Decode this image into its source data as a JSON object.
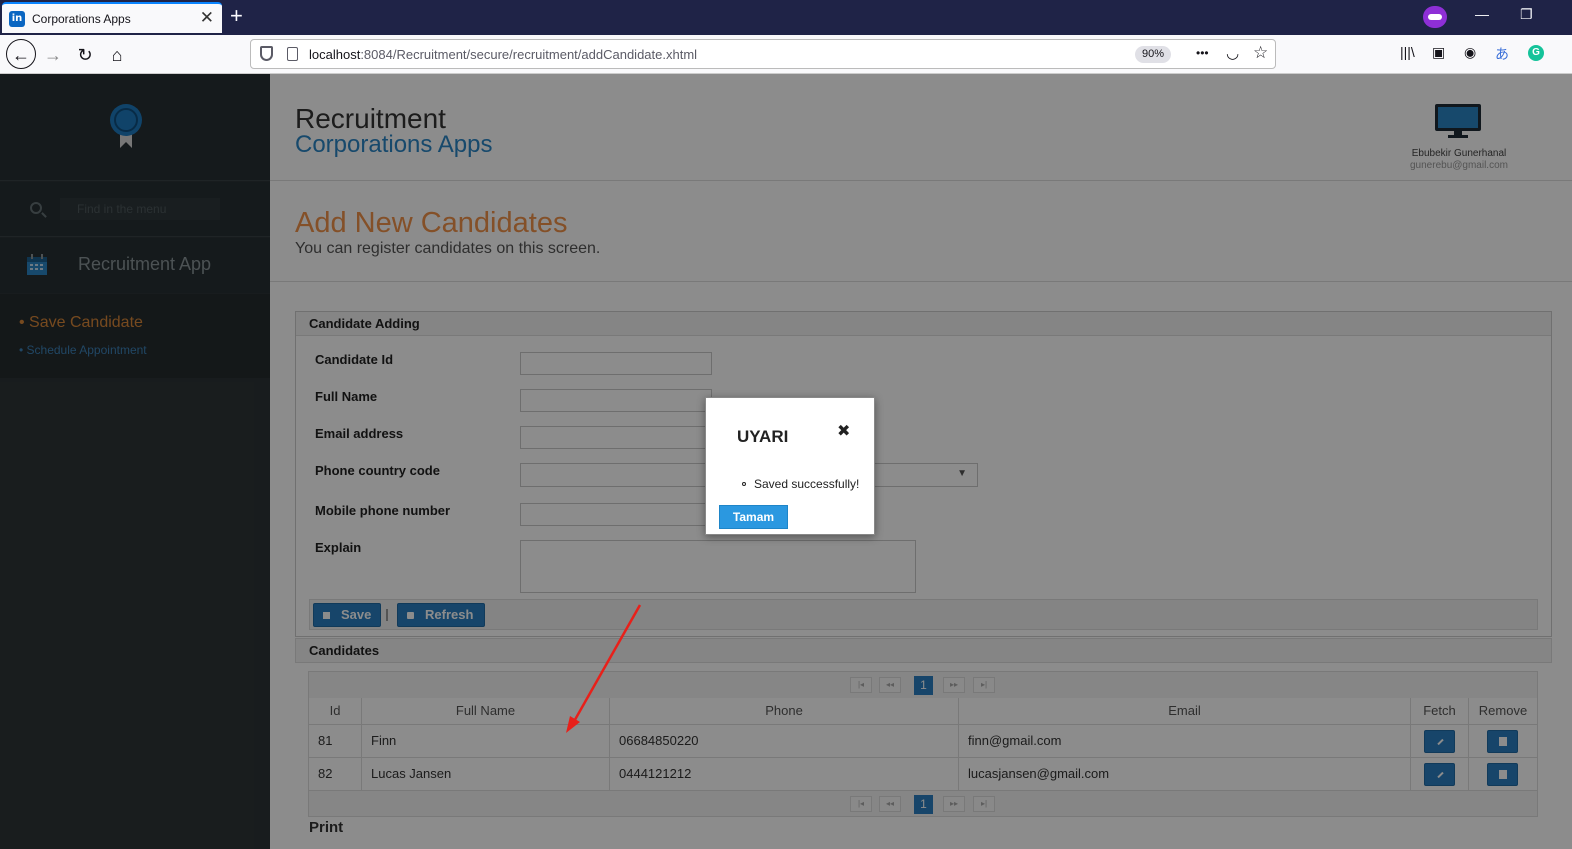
{
  "browser": {
    "tab_title": "Corporations Apps",
    "tab_close": "✕",
    "new_tab": "+",
    "favicon": "in",
    "url_host": "localhost",
    "url_path": ":8084/Recruitment/secure/recruitment/addCandidate.xhtml",
    "zoom": "90%",
    "back_icon": "←",
    "forward_icon": "→",
    "reload_icon": "↻",
    "home_icon": "⌂",
    "more_icon": "•••",
    "pocket_icon": "◡",
    "star_icon": "☆",
    "minimize_icon": "—",
    "restore_icon": "❐",
    "close_icon": "✕",
    "library_icon": "|||\\",
    "sidebar_icon": "▣",
    "account_icon": "◉",
    "translate_icon": "あ",
    "grammarly_icon": "G"
  },
  "sidebar": {
    "search_placeholder": "Find in the menu",
    "app_label": "Recruitment App",
    "items": [
      {
        "label": "• Save Candidate"
      },
      {
        "label": "• Schedule Appointment"
      }
    ]
  },
  "header": {
    "title": "Recruitment",
    "subtitle": "Corporations Apps",
    "user_name": "Ebubekir Gunerhanal",
    "user_email": "gunerebu@gmail.com"
  },
  "page": {
    "title": "Add New Candidates",
    "description": "You can register candidates on this screen."
  },
  "form": {
    "panel_title": "Candidate Adding",
    "fields": {
      "candidate_id": "Candidate Id",
      "full_name": "Full Name",
      "email": "Email address",
      "phone_code": "Phone country code",
      "mobile": "Mobile phone number",
      "explain": "Explain"
    },
    "select_caret": "▼",
    "save_label": "Save",
    "refresh_label": "Refresh"
  },
  "candidates": {
    "panel_title": "Candidates",
    "columns": [
      "Id",
      "Full Name",
      "Phone",
      "Email",
      "Fetch",
      "Remove"
    ],
    "rows": [
      {
        "id": "81",
        "name": "Finn",
        "phone": "06684850220",
        "email": "finn@gmail.com"
      },
      {
        "id": "82",
        "name": "Lucas Jansen",
        "phone": "0444121212",
        "email": "lucasjansen@gmail.com"
      }
    ],
    "pager": {
      "first": "|◂",
      "prev": "◂◂",
      "current": "1",
      "next": "▸▸",
      "last": "▸|"
    },
    "print_label": "Print"
  },
  "dialog": {
    "title": "UYARI",
    "close": "✖",
    "message": "Saved successfully!",
    "ok_label": "Tamam"
  },
  "colors": {
    "accent": "#2b7fc1",
    "title_orange": "#f0924a",
    "sidebar_bg": "#2d3437",
    "arrow": "#e8201a"
  },
  "icons": [
    "shield-icon",
    "calendar-icon",
    "monitor-icon",
    "search-icon",
    "pencil-icon",
    "trash-icon",
    "save-icon",
    "refresh-icon",
    "ribbon-badge-icon"
  ]
}
